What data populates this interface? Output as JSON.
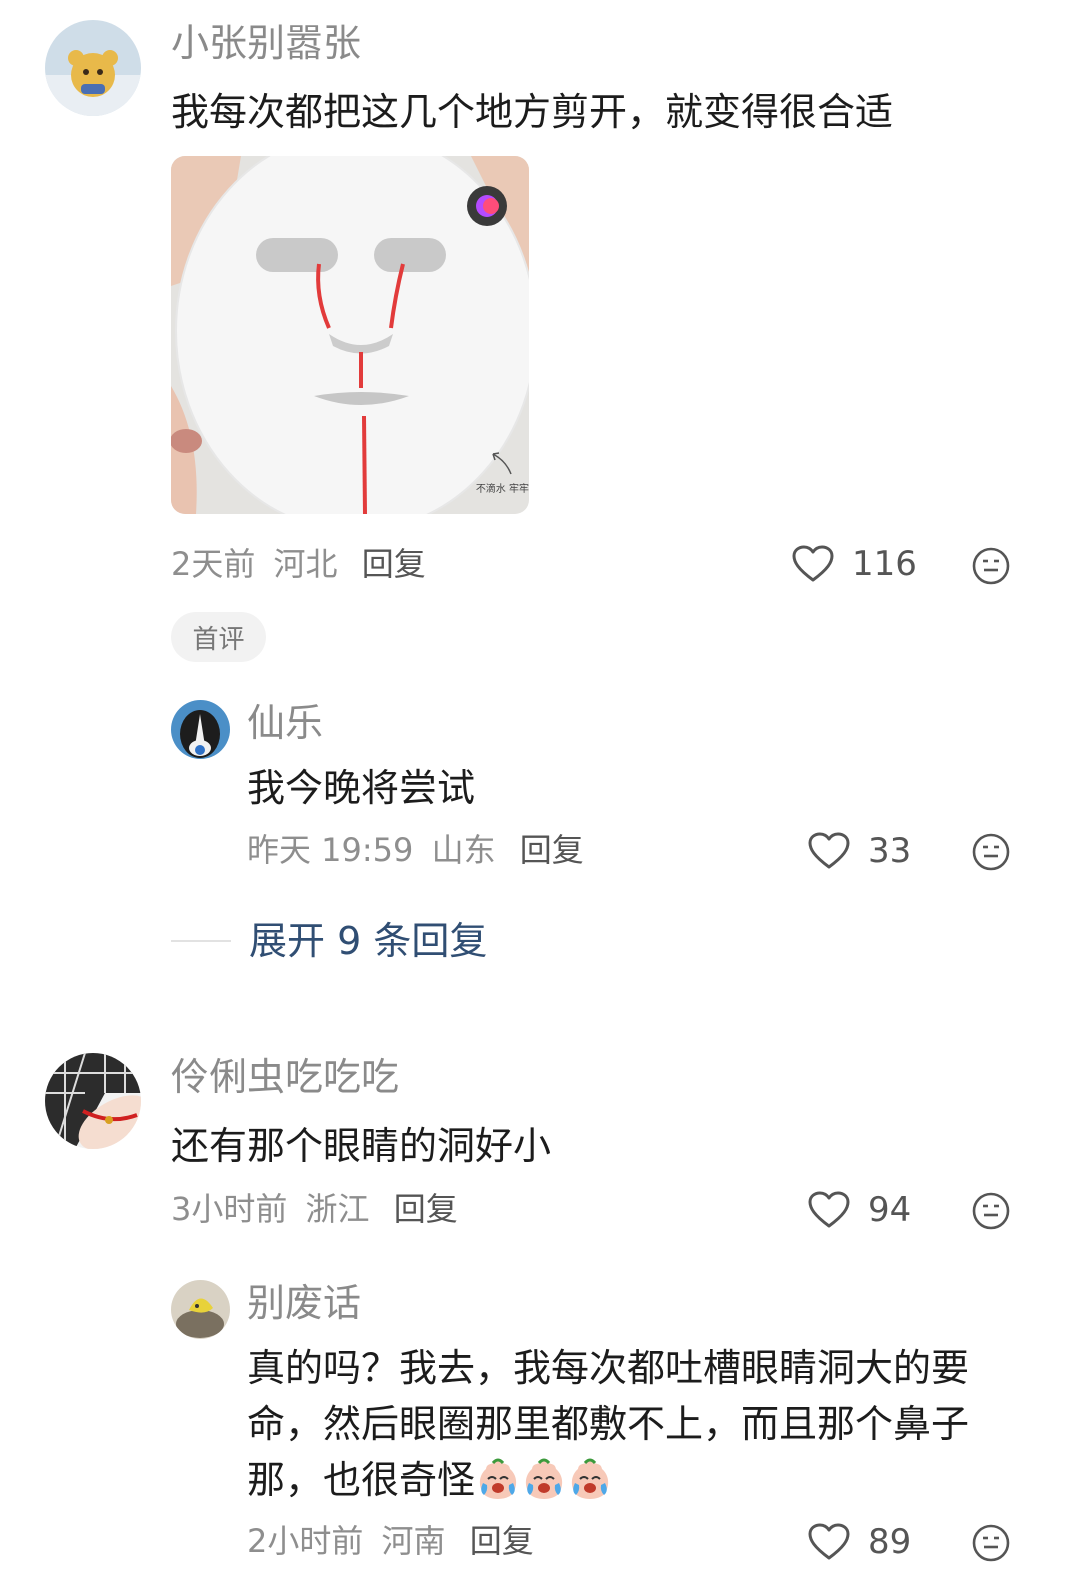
{
  "comments": [
    {
      "username": "小张别嚣张",
      "text": "我每次都把这几个地方剪开，就变得很合适",
      "image_caption": "不滴水 牢牢",
      "time": "2天前",
      "location": "河北",
      "reply_label": "回复",
      "likes": "116",
      "badge": "首评",
      "replies": [
        {
          "username": "仙乐",
          "text": "我今晚将尝试",
          "time": "昨天 19:59",
          "location": "山东",
          "reply_label": "回复",
          "likes": "33"
        }
      ],
      "expand_label": "展开 9 条回复"
    },
    {
      "username": "伶俐虫吃吃吃",
      "text": "还有那个眼睛的洞好小",
      "time": "3小时前",
      "location": "浙江",
      "reply_label": "回复",
      "likes": "94",
      "replies": [
        {
          "username": "别废话",
          "text": "真的吗？我去，我每次都吐槽眼睛洞大的要命，然后眼圈那里都敷不上，而且那个鼻子那，也很奇怪",
          "emojis": [
            "crying-emoji",
            "crying-emoji",
            "crying-emoji"
          ],
          "time": "2小时前",
          "location": "河南",
          "reply_label": "回复",
          "likes": "89"
        }
      ]
    }
  ],
  "colors": {
    "username": "#8a8a8a",
    "text": "#1c1c1c",
    "meta": "#8e8e8e",
    "expand_link": "#304e73",
    "red_cut_line": "#e23b3b"
  }
}
